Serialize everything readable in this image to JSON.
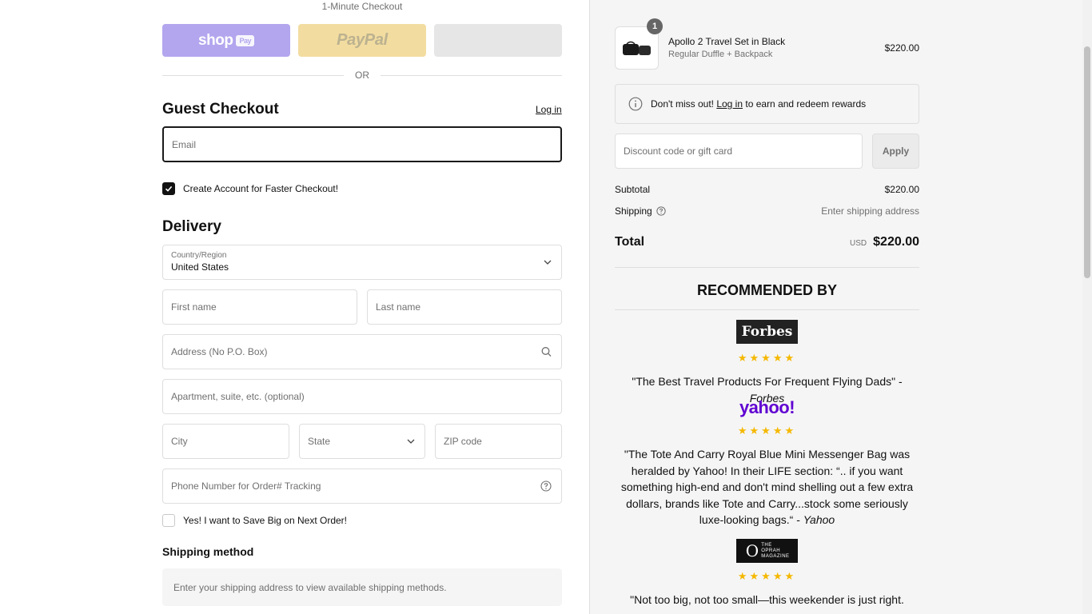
{
  "express": {
    "title": "1-Minute Checkout",
    "shop_label": "shop",
    "shop_chip": "Pay",
    "paypal_label": "PayPal",
    "or_label": "OR"
  },
  "contact": {
    "heading": "Guest Checkout",
    "login_link": "Log in",
    "email_placeholder": "Email",
    "create_account_label": "Create Account for Faster Checkout!"
  },
  "delivery": {
    "heading": "Delivery",
    "country_label": "Country/Region",
    "country_value": "United States",
    "first_name_placeholder": "First name",
    "last_name_placeholder": "Last name",
    "address_placeholder": "Address (No P.O. Box)",
    "apartment_placeholder": "Apartment, suite, etc. (optional)",
    "city_placeholder": "City",
    "state_placeholder": "State",
    "zip_placeholder": "ZIP code",
    "phone_placeholder": "Phone Number for Order# Tracking",
    "save_big_label": "Yes! I want to Save Big on Next Order!"
  },
  "shipping_method": {
    "heading": "Shipping method",
    "info": "Enter your shipping address to view available shipping methods."
  },
  "order": {
    "quantity": "1",
    "product_name": "Apollo 2 Travel Set in Black",
    "product_variant": "Regular Duffle + Backpack",
    "product_price": "$220.00",
    "rewards_pre": "Don't miss out!",
    "rewards_link": "Log in",
    "rewards_post": "to earn and redeem rewards",
    "discount_placeholder": "Discount code or gift card",
    "apply_label": "Apply",
    "subtotal_label": "Subtotal",
    "subtotal_value": "$220.00",
    "shipping_label": "Shipping",
    "shipping_value": "Enter shipping address",
    "total_label": "Total",
    "currency": "USD",
    "total_value": "$220.00"
  },
  "recommended": {
    "title": "RECOMMENDED BY",
    "forbes_logo": "Forbes",
    "yahoo_logo": "yahoo!",
    "oprah_logo_letter": "O",
    "oprah_logo_text": "THE OPRAH MAGAZINE",
    "stars": "★★★★★",
    "forbes_quote": "\"The Best Travel Products For Frequent Flying Dads\" - ",
    "forbes_source": "Forbes",
    "yahoo_quote": "\"The Tote And Carry Royal Blue Mini Messenger Bag was heralded by Yahoo! In their LIFE section: “.. if you want something high-end and don't mind shelling out a few extra dollars, brands like Tote and Carry...stock some seriously luxe-looking bags.“ - ",
    "yahoo_source": "Yahoo",
    "oprah_quote": "\"Not too big, not too small—this weekender is just right. Safe, clean Tote and Tote Designs ...",
    "oprah_quote_line1": "\"Not too big, not too small—this weekender is just right."
  },
  "icons": {
    "info": "info-icon",
    "help": "help-icon",
    "search": "search-icon",
    "chevron": "chevron-down-icon",
    "check": "check-icon"
  },
  "colors": {
    "shop_pay": "#b3a6ee",
    "paypal": "#f2dca0",
    "yahoo": "#6001d2",
    "stars": "#f5b800"
  }
}
